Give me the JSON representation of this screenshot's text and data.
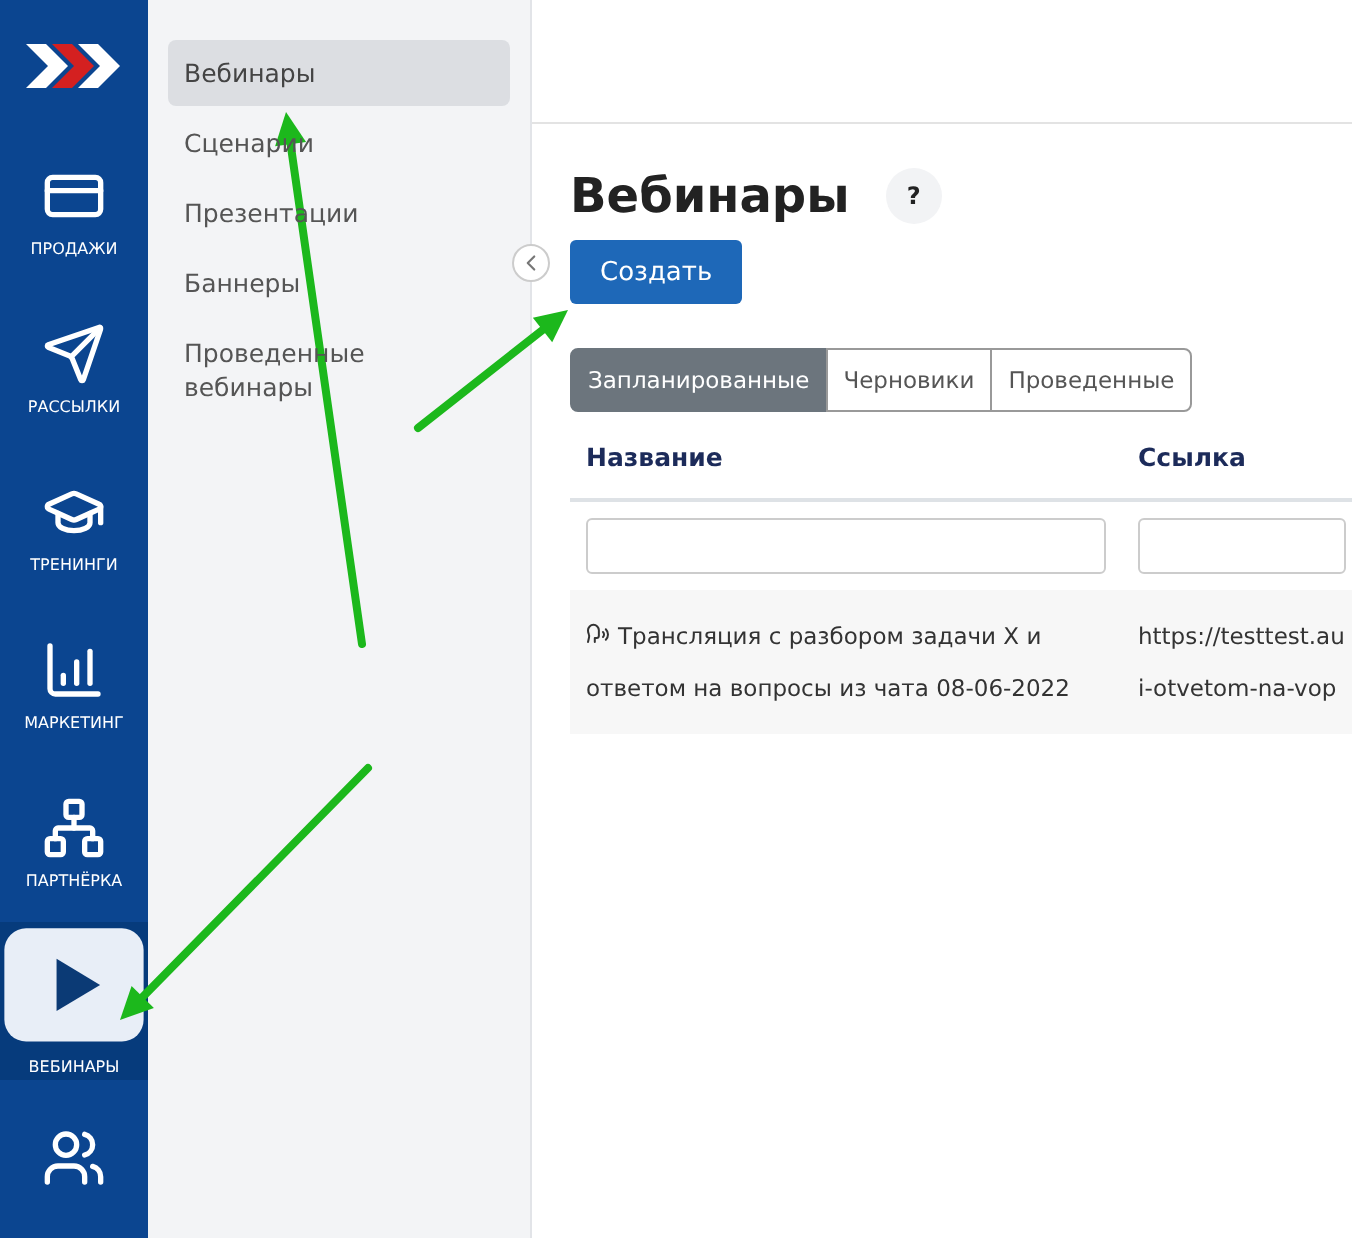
{
  "nav": {
    "items": [
      {
        "kind": "sales",
        "label": "ПРОДАЖИ",
        "selected": false
      },
      {
        "kind": "mail",
        "label": "РАССЫЛКИ",
        "selected": false
      },
      {
        "kind": "training",
        "label": "ТРЕНИНГИ",
        "selected": false
      },
      {
        "kind": "marketing",
        "label": "МАРКЕТИНГ",
        "selected": false
      },
      {
        "kind": "partner",
        "label": "ПАРТНЁРКА",
        "selected": false
      },
      {
        "kind": "webinar",
        "label": "ВЕБИНАРЫ",
        "selected": true
      },
      {
        "kind": "users",
        "selected": false
      }
    ]
  },
  "submenu": {
    "items": [
      {
        "label": "Вебинары",
        "selected": true
      },
      {
        "label": "Сценарии",
        "selected": false
      },
      {
        "label": "Презентации",
        "selected": false
      },
      {
        "label": "Баннеры",
        "selected": false
      },
      {
        "label": "Проведенные вебинары",
        "selected": false
      }
    ]
  },
  "page": {
    "title": "Вебинары",
    "help": "?",
    "create_button": "Создать"
  },
  "tabs": [
    {
      "label": "Запланированные",
      "selected": true
    },
    {
      "label": "Черновики",
      "selected": false
    },
    {
      "label": "Проведенные",
      "selected": false
    }
  ],
  "table": {
    "columns": [
      "Название",
      "Ссылка"
    ],
    "rows": [
      {
        "name": "Трансляция с разбором задачи X и ответом на вопросы из чата 08-06-2022",
        "link": [
          "https://testtest.au",
          "i-otvetom-na-vop"
        ]
      }
    ]
  }
}
